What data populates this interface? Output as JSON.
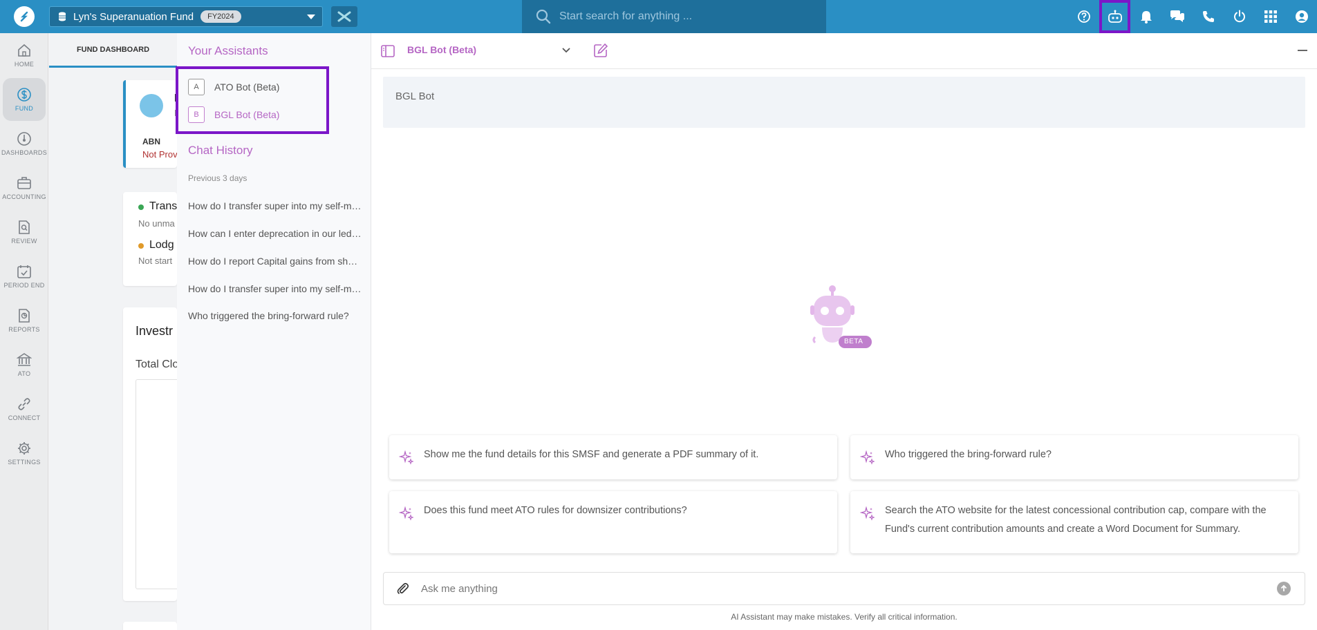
{
  "topbar": {
    "fund_name": "Lyn's Superanuation Fund",
    "fy_badge": "FY2024",
    "search_placeholder": "Start search for anything ...",
    "icons": [
      "help-icon",
      "bot-icon",
      "bell-icon",
      "chat-icon",
      "phone-icon",
      "power-icon",
      "apps-grid-icon",
      "user-icon"
    ]
  },
  "nav": {
    "items": [
      {
        "label": "HOME",
        "icon": "home-icon"
      },
      {
        "label": "FUND",
        "icon": "dollar-icon"
      },
      {
        "label": "DASHBOARDS",
        "icon": "gauge-icon"
      },
      {
        "label": "ACCOUNTING",
        "icon": "briefcase-icon"
      },
      {
        "label": "REVIEW",
        "icon": "doc-search-icon"
      },
      {
        "label": "PERIOD END",
        "icon": "calendar-check-icon"
      },
      {
        "label": "REPORTS",
        "icon": "report-icon"
      },
      {
        "label": "ATO",
        "icon": "bank-icon"
      },
      {
        "label": "CONNECT",
        "icon": "link-icon"
      },
      {
        "label": "SETTINGS",
        "icon": "gear-icon"
      }
    ]
  },
  "dashboard": {
    "tab": "FUND DASHBOARD",
    "card1": {
      "title": "L",
      "sub": "N",
      "abn_label": "ABN",
      "abn_value": "Not Prov"
    },
    "card2": {
      "item1": "Trans",
      "item1_sub": "No unma",
      "item2": "Lodg",
      "item2_sub": "Not start"
    },
    "card3": {
      "title": "Investr",
      "sub": "Total Clo"
    }
  },
  "assistants": {
    "title": "Your Assistants",
    "items": [
      {
        "letter": "A",
        "name": "ATO Bot (Beta)"
      },
      {
        "letter": "B",
        "name": "BGL Bot (Beta)"
      }
    ],
    "history_title": "Chat History",
    "history_group": "Previous 3 days",
    "history": [
      "How do I transfer super into my self-managed fund?",
      "How can I enter deprecation in our ledger?",
      "How do I report Capital gains from shares?",
      "How do I transfer super into my self-managed fund?",
      "Who triggered the bring-forward rule?"
    ]
  },
  "chat": {
    "bot_title": "BGL Bot (Beta)",
    "banner": "BGL Bot",
    "beta_badge": "BETA",
    "prompts": [
      "Show me the fund details for this SMSF and generate a PDF summary of it.",
      "Who triggered the bring-forward rule?",
      "Does this fund meet ATO rules for downsizer contributions?",
      "Search the ATO website for the latest concessional contribution cap, compare with the Fund's current contribution amounts and create a Word Document for Summary."
    ],
    "input_placeholder": "Ask me anything",
    "disclaimer": "AI Assistant may make mistakes. Verify all critical information."
  },
  "colors": {
    "topbar": "#2a8fc4",
    "accent_purple": "#b566c4",
    "highlight_outline": "#7b16c8"
  }
}
